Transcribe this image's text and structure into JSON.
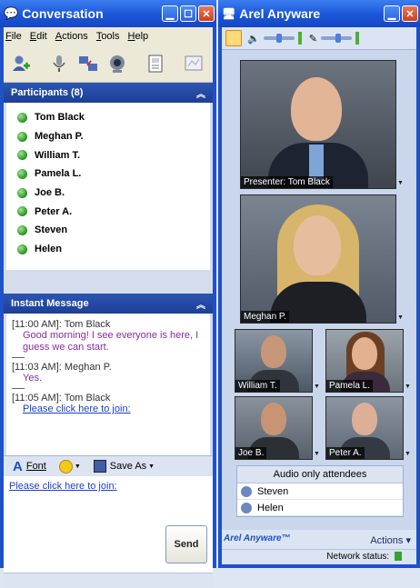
{
  "conversation_window": {
    "title": "Conversation",
    "menu": [
      "File",
      "Edit",
      "Actions",
      "Tools",
      "Help"
    ],
    "toolbar_icons": [
      "add-participant-icon",
      "microphone-icon",
      "share-desktop-icon",
      "webcam-icon",
      "document-icon",
      "whiteboard-icon"
    ],
    "participants_header": "Participants (8)",
    "participants": [
      "Tom Black",
      "Meghan P.",
      "William T.",
      "Pamela L.",
      "Joe B.",
      "Peter A.",
      "Steven",
      "Helen"
    ],
    "im_header": "Instant Message",
    "messages": [
      {
        "time": "[11:00 AM]:",
        "sender": "Tom Black",
        "text": "Good morning! I see everyone is here, I guess we can start."
      },
      {
        "time": "[11:03 AM]:",
        "sender": "Meghan P.",
        "text": "Yes."
      },
      {
        "time": "[11:05 AM]:",
        "sender": "Tom Black",
        "link": "Please click here to join:"
      }
    ],
    "format_bar": {
      "font": "Font",
      "save_as": "Save As"
    },
    "compose_text": "Please click here to join:",
    "send_label": "Send"
  },
  "arel_window": {
    "title": "Arel Anyware",
    "videos": {
      "presenter": "Presenter: Tom Black",
      "main2": "Meghan P.",
      "t1": "William T.",
      "t2": "Pamela L.",
      "t3": "Joe B.",
      "t4": "Peter A."
    },
    "audio_title": "Audio only attendees",
    "audio_attendees": [
      "Steven",
      "Helen"
    ],
    "logo": "Arel Anyware™",
    "actions_label": "Actions",
    "network_status": "Network status:"
  },
  "colors": {
    "titlebar": "#1a56d9",
    "panel_header": "#1d3e95",
    "participant_dot": "#2a9a24",
    "im_text": "#8a2aa0",
    "link": "#1c3fc4"
  }
}
